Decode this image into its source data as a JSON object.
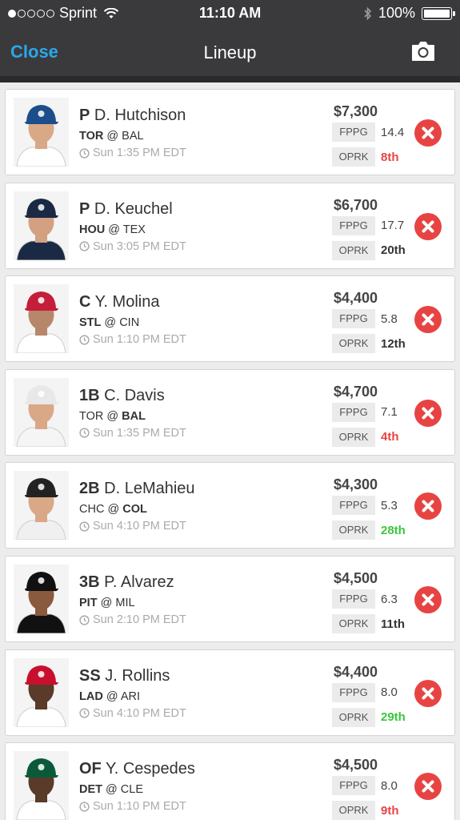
{
  "status_bar": {
    "carrier": "Sprint",
    "time": "11:10 AM",
    "battery": "100%",
    "signal_icon": "signal-dots-icon",
    "wifi_icon": "wifi-icon",
    "bluetooth_icon": "bluetooth-icon",
    "battery_icon": "battery-icon"
  },
  "nav": {
    "close_label": "Close",
    "title": "Lineup",
    "camera_icon": "camera-icon"
  },
  "colors": {
    "header_bg": "#3a3a3c",
    "accent": "#2aa7e8",
    "remove": "#e84343",
    "rank_bad": "#e84343",
    "rank_good": "#3cc63c",
    "rank_neutral": "#333333"
  },
  "players": [
    {
      "pos": "P",
      "name": "D. Hutchison",
      "team": "TOR",
      "sep": "@",
      "opp": "BAL",
      "bold_side": "team",
      "time": "Sun 1:35 PM EDT",
      "salary": "$7,300",
      "fppg_label": "FPPG",
      "fppg": "14.4",
      "oprk_label": "OPRK",
      "oprk": "8th",
      "oprk_color": "#e84343",
      "cap": "#1d4d8a",
      "jersey": "#ffffff",
      "skin": "#d9a887"
    },
    {
      "pos": "P",
      "name": "D. Keuchel",
      "team": "HOU",
      "sep": "@",
      "opp": "TEX",
      "bold_side": "team",
      "time": "Sun 3:05 PM EDT",
      "salary": "$6,700",
      "fppg_label": "FPPG",
      "fppg": "17.7",
      "oprk_label": "OPRK",
      "oprk": "20th",
      "oprk_color": "#333333",
      "cap": "#1b2a44",
      "jersey": "#1b2a44",
      "skin": "#d3a082"
    },
    {
      "pos": "C",
      "name": "Y. Molina",
      "team": "STL",
      "sep": "@",
      "opp": "CIN",
      "bold_side": "team",
      "time": "Sun 1:10 PM EDT",
      "salary": "$4,400",
      "fppg_label": "FPPG",
      "fppg": "5.8",
      "oprk_label": "OPRK",
      "oprk": "12th",
      "oprk_color": "#333333",
      "cap": "#c41e3a",
      "jersey": "#ffffff",
      "skin": "#b7876a"
    },
    {
      "pos": "1B",
      "name": "C. Davis",
      "team": "TOR",
      "sep": "@",
      "opp": "BAL",
      "bold_side": "opp",
      "time": "Sun 1:35 PM EDT",
      "salary": "$4,700",
      "fppg_label": "FPPG",
      "fppg": "7.1",
      "oprk_label": "OPRK",
      "oprk": "4th",
      "oprk_color": "#e84343",
      "cap": "#e8e8e8",
      "jersey": "#f5f5f5",
      "skin": "#d9a887"
    },
    {
      "pos": "2B",
      "name": "D. LeMahieu",
      "team": "CHC",
      "sep": "@",
      "opp": "COL",
      "bold_side": "opp",
      "time": "Sun 4:10 PM EDT",
      "salary": "$4,300",
      "fppg_label": "FPPG",
      "fppg": "5.3",
      "oprk_label": "OPRK",
      "oprk": "28th",
      "oprk_color": "#3cc63c",
      "cap": "#222222",
      "jersey": "#f0f0f0",
      "skin": "#d9a887"
    },
    {
      "pos": "3B",
      "name": "P. Alvarez",
      "team": "PIT",
      "sep": "@",
      "opp": "MIL",
      "bold_side": "team",
      "time": "Sun 2:10 PM EDT",
      "salary": "$4,500",
      "fppg_label": "FPPG",
      "fppg": "6.3",
      "oprk_label": "OPRK",
      "oprk": "11th",
      "oprk_color": "#333333",
      "cap": "#111111",
      "jersey": "#111111",
      "skin": "#8a5a3e"
    },
    {
      "pos": "SS",
      "name": "J. Rollins",
      "team": "LAD",
      "sep": "@",
      "opp": "ARI",
      "bold_side": "team",
      "time": "Sun 4:10 PM EDT",
      "salary": "$4,400",
      "fppg_label": "FPPG",
      "fppg": "8.0",
      "oprk_label": "OPRK",
      "oprk": "29th",
      "oprk_color": "#3cc63c",
      "cap": "#c8102e",
      "jersey": "#ffffff",
      "skin": "#5a3a28"
    },
    {
      "pos": "OF",
      "name": "Y. Cespedes",
      "team": "DET",
      "sep": "@",
      "opp": "CLE",
      "bold_side": "team",
      "time": "Sun 1:10 PM EDT",
      "salary": "$4,500",
      "fppg_label": "FPPG",
      "fppg": "8.0",
      "oprk_label": "OPRK",
      "oprk": "9th",
      "oprk_color": "#e84343",
      "cap": "#0a5a3a",
      "jersey": "#ffffff",
      "skin": "#5a3a28"
    }
  ]
}
